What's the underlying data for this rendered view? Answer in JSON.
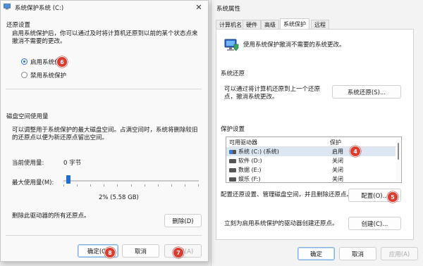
{
  "colors": {
    "accent": "#1f6fd1",
    "badge": "#e03a2e",
    "selection": "#dde7f3"
  },
  "sys_props": {
    "title": "系统属性",
    "tabs": [
      "计算机名",
      "硬件",
      "高级",
      "系统保护",
      "远程"
    ],
    "intro": "使用系统保护撤消不需要的系统更改。",
    "restore_section": "系统还原",
    "restore_desc": "可以通过将计算机还原到上一个还原点，撤消系统更改。",
    "restore_button": "系统还原(S)...",
    "protection_section": "保护设置",
    "columns": [
      "可用驱动器",
      "保护"
    ],
    "drives": [
      {
        "name": "系统 (C:) (系统)",
        "status": "启用"
      },
      {
        "name": "软件 (D:)",
        "status": "关闭"
      },
      {
        "name": "数据 (E:)",
        "status": "关闭"
      },
      {
        "name": "娱乐 (F:)",
        "status": "关闭"
      }
    ],
    "config_desc": "配置还原设置、管理磁盘空间，并且删除还原点。",
    "config_button": "配置(O)...",
    "create_desc": "立刻为启用系统保护的驱动器创建还原点。",
    "create_button": "创建(C)...",
    "ok": "确定",
    "cancel": "取消",
    "apply": "应用(A)"
  },
  "dialog": {
    "title": "系统保护系统 (C:)",
    "restore_settings": "还原设置",
    "restore_desc": "启用系统保护后，你可以通过及时将计算机还原到以前的某个状态点来撤消不需要的更改。",
    "enable_label": "启用系统保护",
    "disable_label": "禁用系统保护",
    "disk_usage": "磁盘空间使用量",
    "disk_desc": "可以调整用于系统保护的最大磁盘空间。占满空间时，系统将删除较旧的还原点以便为新还原点留出空间。",
    "current_label": "当前使用量:",
    "current_value": "0 字节",
    "max_label": "最大使用量(M):",
    "slider_fraction": 0.02,
    "slider_value": "2% (5.58 GB)",
    "delete_desc": "删除此驱动器的所有还原点。",
    "delete_button": "删除(D)",
    "ok": "确定(O)",
    "cancel": "取消",
    "apply": "应用(A)"
  },
  "badges": {
    "b4": "4",
    "b5": "5",
    "b6": "6",
    "b7": "7",
    "b8": "8"
  }
}
